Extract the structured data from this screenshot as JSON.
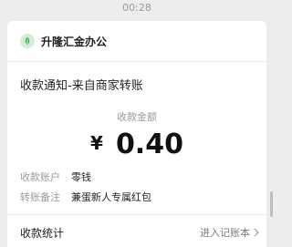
{
  "timestamp": "00:28",
  "app": {
    "name": "升隆汇金办公",
    "icon": "leaf-icon",
    "accent": "#3ab54a"
  },
  "notice": {
    "title": "收款通知-来自商家转账",
    "amount_label": "收款金额",
    "currency": "¥",
    "amount": "0.40",
    "details": [
      {
        "key": "收款账户",
        "value": "零钱"
      },
      {
        "key": "转账备注",
        "value": "兼蛋新人专属红包"
      }
    ]
  },
  "footer": {
    "left": "收款统计",
    "right": "进入记账本"
  }
}
